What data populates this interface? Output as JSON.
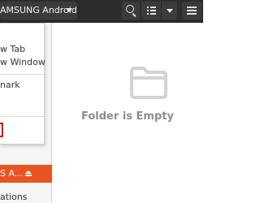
{
  "header": {
    "path_label": "AMSUNG Android",
    "path_menu_icon": "chevron-down-icon",
    "search_icon": "search-icon",
    "view_icon": "list-view-icon",
    "view_menu_icon": "chevron-down-icon",
    "menu_icon": "hamburger-menu-icon"
  },
  "context_menu": {
    "items": [
      {
        "label": "w Tab"
      },
      {
        "label": "w Window"
      },
      {
        "label": "nark"
      }
    ]
  },
  "sidebar": {
    "selected_label": "S A...",
    "selected_icon": "eject-icon",
    "next_label": "ations",
    "accent": "#e95420"
  },
  "main": {
    "empty_label": "Folder is Empty",
    "empty_icon": "folder-icon"
  }
}
